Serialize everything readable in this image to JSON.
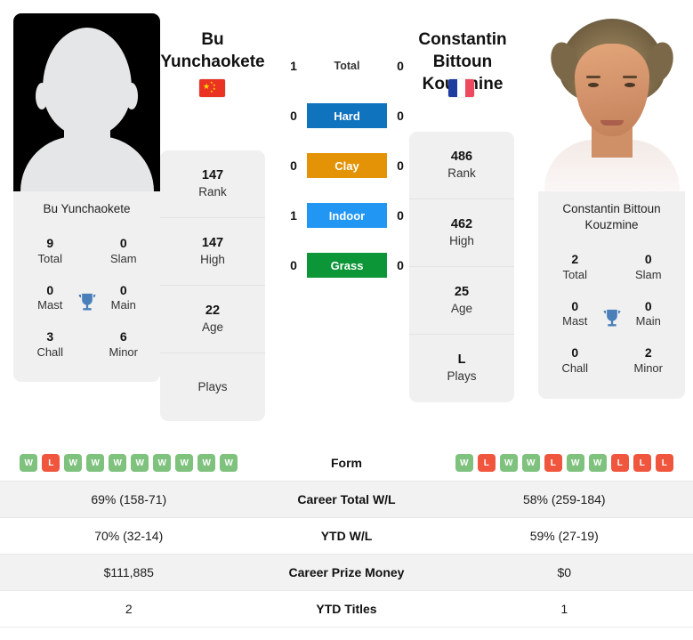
{
  "players": {
    "left": {
      "name_line1": "Bu",
      "name_line2": "Yunchaokete",
      "card_name": "Bu Yunchaokete",
      "country": "China",
      "flag_icon": "flag-china",
      "photo": "placeholder-silhouette",
      "titles": {
        "total_val": "9",
        "total_lab": "Total",
        "slam_val": "0",
        "slam_lab": "Slam",
        "mast_val": "0",
        "mast_lab": "Mast",
        "main_val": "0",
        "main_lab": "Main",
        "chall_val": "3",
        "chall_lab": "Chall",
        "minor_val": "6",
        "minor_lab": "Minor"
      },
      "ranking": {
        "rank_val": "147",
        "rank_lab": "Rank",
        "high_val": "147",
        "high_lab": "High",
        "age_val": "22",
        "age_lab": "Age",
        "plays_val": "",
        "plays_lab": "Plays"
      }
    },
    "right": {
      "name_line1": "Constantin",
      "name_line2": "Bittoun Kouzmine",
      "card_name": "Constantin Bittoun Kouzmine",
      "country": "France",
      "flag_icon": "flag-france",
      "photo": "player-portrait",
      "titles": {
        "total_val": "2",
        "total_lab": "Total",
        "slam_val": "0",
        "slam_lab": "Slam",
        "mast_val": "0",
        "mast_lab": "Mast",
        "main_val": "0",
        "main_lab": "Main",
        "chall_val": "0",
        "chall_lab": "Chall",
        "minor_val": "2",
        "minor_lab": "Minor"
      },
      "ranking": {
        "rank_val": "486",
        "rank_lab": "Rank",
        "high_val": "462",
        "high_lab": "High",
        "age_val": "25",
        "age_lab": "Age",
        "plays_val": "L",
        "plays_lab": "Plays"
      }
    }
  },
  "h2h": {
    "total": {
      "label": "Total",
      "left": "1",
      "right": "0"
    },
    "surfaces": [
      {
        "label": "Hard",
        "left": "0",
        "right": "0",
        "color": "#1073be"
      },
      {
        "label": "Clay",
        "left": "0",
        "right": "0",
        "color": "#e39305"
      },
      {
        "label": "Indoor",
        "left": "1",
        "right": "0",
        "color": "#2196f3"
      },
      {
        "label": "Grass",
        "left": "0",
        "right": "0",
        "color": "#0d9638"
      }
    ]
  },
  "comparison": {
    "form": {
      "label": "Form",
      "left": [
        "W",
        "L",
        "W",
        "W",
        "W",
        "W",
        "W",
        "W",
        "W",
        "W"
      ],
      "right": [
        "W",
        "L",
        "W",
        "W",
        "L",
        "W",
        "W",
        "L",
        "L",
        "L"
      ]
    },
    "rows": [
      {
        "label": "Career Total W/L",
        "left": "69% (158-71)",
        "right": "58% (259-184)"
      },
      {
        "label": "YTD W/L",
        "left": "70% (32-14)",
        "right": "59% (27-19)"
      },
      {
        "label": "Career Prize Money",
        "left": "$111,885",
        "right": "$0"
      },
      {
        "label": "YTD Titles",
        "left": "2",
        "right": "1"
      }
    ]
  },
  "theme": {
    "trophy_color": "#4a7fba",
    "win_color": "#7ec27e",
    "loss_color": "#f0553d"
  }
}
